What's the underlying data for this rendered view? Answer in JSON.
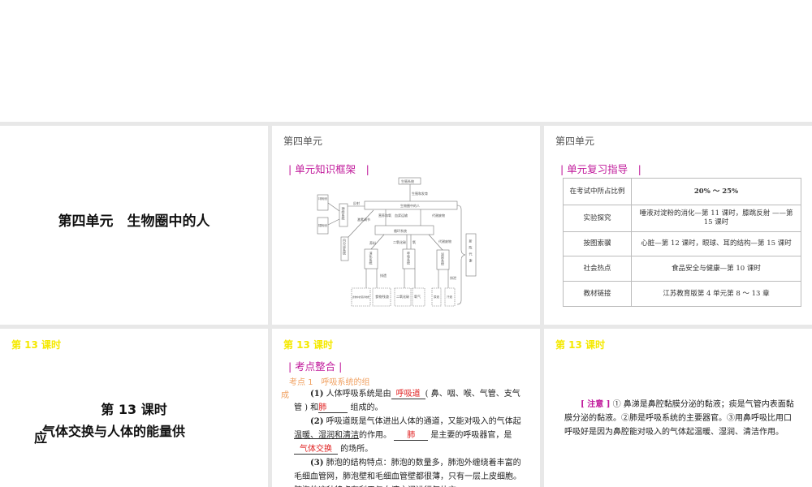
{
  "slide1": {
    "title": "第四单元　生物圈中的人"
  },
  "slide2": {
    "unit": "第四单元",
    "section": "| 单元知识框架　|",
    "diagram": {
      "reproductive": "生殖系统",
      "reproduction_dev": "生殖和发育",
      "main": "生物圈中的人",
      "cns": "中枢神经系统",
      "pns": "周围神经系统",
      "nervous": "神经系统",
      "reflex": "反射",
      "hormone": "激素调节",
      "endocrine": "内分泌系统",
      "nutrients_o2": "营养和氧",
      "plasma": "血浆运输",
      "waste1": "代谢废物",
      "circulatory": "循环系统",
      "nutrition": "养料",
      "co2_label": "二氧化碳",
      "o2_label": "氧",
      "waste2": "代谢废物",
      "digestive": "消化系统",
      "respiratory": "呼吸系统",
      "urinary": "泌尿系统",
      "egestion": "排遗",
      "excretion": "排泄",
      "metabolism": "新陈代谢",
      "food_nutrients": "食物中的营养物质",
      "food_residue": "食物残渣",
      "co2": "二氧化碳",
      "oxygen": "氧气",
      "urine": "尿液",
      "sweat": "汗液"
    }
  },
  "slide3": {
    "unit": "第四单元",
    "section": "| 单元复习指导　|",
    "rows": [
      {
        "key": "在考试中所占比例",
        "value": "20% ～ 25%"
      },
      {
        "key": "实验探究",
        "value": "唾液对淀粉的消化—第 11 课时，膝跳反射 ——第 15 课时"
      },
      {
        "key": "按图索骥",
        "value": "心脏—第 12 课时，眼球、耳的结构—第 15 课时"
      },
      {
        "key": "社会热点",
        "value": "食品安全与健康—第 10 课时"
      },
      {
        "key": "教材链接",
        "value": "江苏教育版第 4 单元第 8 ～ 13 章"
      }
    ]
  },
  "slide4": {
    "lesson": "第 13 课时",
    "title1": "第 13 课时",
    "title2": "气体交换与人体的能量供",
    "title3": "应"
  },
  "slide5": {
    "lesson": "第 13 课时",
    "section": "| 考点整合 |",
    "point": "考点 1　呼吸系统的组",
    "point_cont": "成",
    "p1a": "(1)",
    "p1b": " 人体呼吸系统是由",
    "p1_fill1": "呼吸道",
    "p1c": "( 鼻、咽、喉、气管、支气管 ) 和",
    "p1_fill2": "肺",
    "p1d": " 组成的。",
    "p2a": "(2)",
    "p2b": " 呼吸道既是气体进出人体的通道，又能对吸入的气体起",
    "p2_ul": "温暖、湿润和清洁",
    "p2c": "的作用。",
    "p2_fill1": "肺",
    "p2d": " 是主要的呼吸器官，是 ",
    "p2_fill2": "气体交换",
    "p2e": " 的场所。",
    "p3a": "(3)",
    "p3b": " 肺泡的结构特点：肺泡的数量多，肺泡外缠绕着丰富的毛细血管网，肺泡壁和毛细血管壁都很薄，只有一层上皮细胞。肺泡的这种特点有利于与血液之间进行气体交"
  },
  "slide6": {
    "lesson": "第 13 课时",
    "note_label": "[ 注意 ]",
    "note_text": " ① 鼻涕是鼻腔黏膜分泌的黏液；痰是气管内表面黏膜分泌的黏液。②肺是呼吸系统的主要器官。③用鼻呼吸比用口呼吸好是因为鼻腔能对吸入的气体起温暖、湿润、清洁作用。"
  }
}
